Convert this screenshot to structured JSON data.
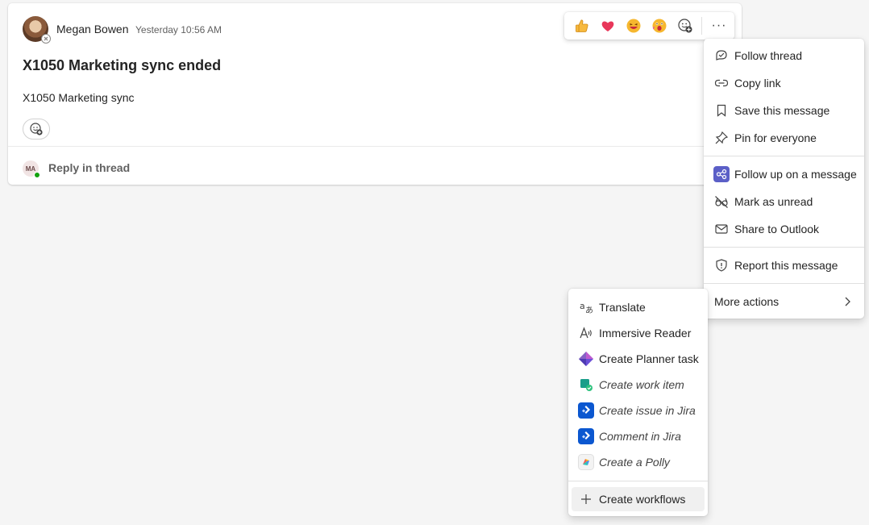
{
  "message": {
    "author": "Megan Bowen",
    "timestamp": "Yesterday 10:56 AM",
    "title": "X1050 Marketing sync ended",
    "body": "X1050 Marketing sync",
    "reply_initials": "MA",
    "reply_label": "Reply in thread"
  },
  "reactions": [
    {
      "name": "like",
      "glyph": "👍"
    },
    {
      "name": "heart",
      "glyph": "❤"
    },
    {
      "name": "laugh",
      "glyph": "😆"
    },
    {
      "name": "surprised",
      "glyph": "😮"
    }
  ],
  "more_options_label": "···",
  "menu": {
    "items": [
      {
        "label": "Follow thread",
        "icon": "follow-thread-icon"
      },
      {
        "label": "Copy link",
        "icon": "link-icon"
      },
      {
        "label": "Save this message",
        "icon": "bookmark-icon"
      },
      {
        "label": "Pin for everyone",
        "icon": "pin-icon"
      },
      {
        "label": "Follow up on a message",
        "icon": "follow-up-app-icon"
      },
      {
        "label": "Mark as unread",
        "icon": "unread-icon"
      },
      {
        "label": "Share to Outlook",
        "icon": "mail-icon"
      },
      {
        "label": "Report this message",
        "icon": "shield-icon"
      },
      {
        "label": "More actions",
        "icon": "chevron-right-icon"
      }
    ]
  },
  "submenu": {
    "items": [
      {
        "label": "Translate",
        "icon": "translate-icon"
      },
      {
        "label": "Immersive Reader",
        "icon": "immersive-reader-icon"
      },
      {
        "label": "Create Planner task",
        "icon": "planner-icon"
      },
      {
        "label": "Create work item",
        "icon": "work-item-icon"
      },
      {
        "label": "Create issue in Jira",
        "icon": "jira-icon"
      },
      {
        "label": "Comment in Jira",
        "icon": "jira-icon"
      },
      {
        "label": "Create a Polly",
        "icon": "polly-icon"
      },
      {
        "label": "Create workflows",
        "icon": "plus-icon"
      }
    ]
  },
  "colors": {
    "accent": "#5b5fc7",
    "jira": "#0b57d0",
    "presence_available": "#13a10e"
  }
}
